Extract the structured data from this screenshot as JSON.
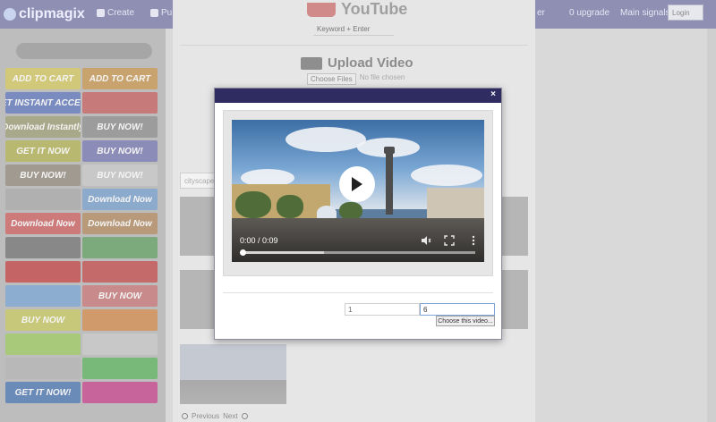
{
  "navbar": {
    "logo_text": "clipmagix",
    "items": [
      {
        "label": "Create"
      },
      {
        "label": "Pu"
      },
      {
        "label": "er"
      },
      {
        "label": "0 upgrade"
      },
      {
        "label": "Main signals"
      }
    ],
    "login_label": "Login"
  },
  "sidebar": {
    "ads": [
      {
        "label": "ADD TO CART",
        "color": "#d2c87a"
      },
      {
        "label": "ADD TO CART",
        "color": "#c9a36e"
      },
      {
        "label": "GET INSTANT ACCESS",
        "color": "#7a8cbf"
      },
      {
        "label": "",
        "color": "#c77a7a"
      },
      {
        "label": "Download Instantly",
        "color": "#a8a88a"
      },
      {
        "label": "BUY NOW!",
        "color": "#9c9c9c"
      },
      {
        "label": "GET IT NOW",
        "color": "#b8b870"
      },
      {
        "label": "BUY NOW!",
        "color": "#8c8cb8"
      },
      {
        "label": "BUY NOW!",
        "color": "#a09a90"
      },
      {
        "label": "BUY NOW!",
        "color": "#c8c8c8"
      },
      {
        "label": "",
        "color": "#b0b0b0"
      },
      {
        "label": "Download Now",
        "color": "#8caacc"
      },
      {
        "label": "Download Now",
        "color": "#cc7a7a"
      },
      {
        "label": "Download Now",
        "color": "#b89a7a"
      },
      {
        "label": "",
        "color": "#888888"
      },
      {
        "label": "",
        "color": "#7caa7c"
      },
      {
        "label": "",
        "color": "#c46464"
      },
      {
        "label": "",
        "color": "#c46a6a"
      },
      {
        "label": "",
        "color": "#8cacd0"
      },
      {
        "label": "BUY NOW",
        "color": "#c88a8a"
      },
      {
        "label": "BUY NOW",
        "color": "#c8c87a"
      },
      {
        "label": "",
        "color": "#d09a6a"
      },
      {
        "label": "",
        "color": "#a8c87a"
      },
      {
        "label": "",
        "color": "#c8c8c8"
      },
      {
        "label": "",
        "color": "#b8b8b8"
      },
      {
        "label": "",
        "color": "#78b878"
      },
      {
        "label": "GET IT NOW!",
        "color": "#6a8ab8"
      },
      {
        "label": "",
        "color": "#c8649c"
      }
    ]
  },
  "page": {
    "youtube_label": "YouTube",
    "keyword_placeholder": "Keyword + Enter",
    "upload_title": "Upload Video",
    "choose_files_label": "Choose Files",
    "no_file_label": "No file chosen",
    "search_value": "cityscape",
    "pager": {
      "previous_label": "Previous",
      "next_label": "Next"
    }
  },
  "modal": {
    "close_label": "×",
    "player": {
      "time_display": "0:00 / 0:09",
      "progress": 0.35,
      "state": "paused",
      "icons": [
        "play-icon",
        "volume-icon",
        "fullscreen-icon",
        "more-options-icon"
      ]
    },
    "start_value": "1",
    "end_value": "6",
    "choose_button_label": "Choose this video..."
  },
  "colors": {
    "modal_header": "#2e2c60",
    "navbar_overlay": "#8f8fb4"
  }
}
